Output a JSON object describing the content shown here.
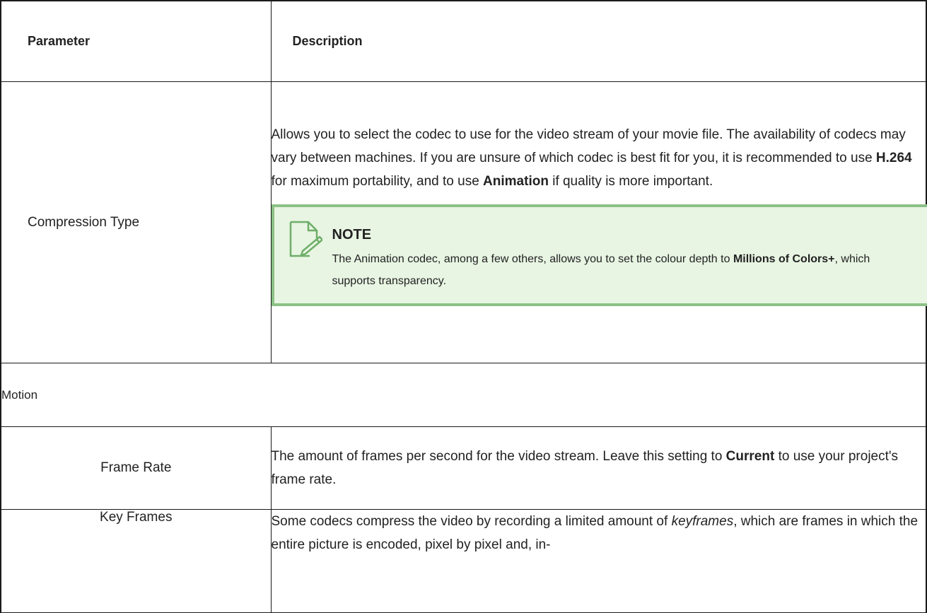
{
  "table": {
    "headers": {
      "parameter": "Parameter",
      "description": "Description"
    },
    "rows": {
      "compression_type": {
        "parameter": "Compression Type",
        "description_parts": {
          "p1": "Allows you to select the codec to use for the video stream of your movie file. The availability of codecs may vary between machines. If you are unsure of which codec is best fit for you, it is recommended to use ",
          "b1": "H.264",
          "p2": " for maximum portability, and to use ",
          "b2": "Animation",
          "p3": " if quality is more important."
        },
        "note": {
          "title": "NOTE",
          "text_parts": {
            "t1": "The Animation codec, among a few others, allows you to set the colour depth to ",
            "b1": "Millions of Colors+",
            "t2": ", which supports transparency."
          },
          "icon": "note-pencil-icon"
        }
      },
      "motion_section": {
        "label": "Motion"
      },
      "frame_rate": {
        "parameter": "Frame Rate",
        "description_parts": {
          "p1": "The amount of frames per second for the video stream. Leave this setting to ",
          "b1": "Current",
          "p2": " to use your project's frame rate."
        }
      },
      "key_frames": {
        "parameter": "Key Frames",
        "description_parts": {
          "p1": "Some codecs compress the video by recording a limited amount of ",
          "i1": "keyframes",
          "p2": ", which are frames in which the entire picture is encoded, pixel by pixel and, in-"
        }
      }
    }
  },
  "colors": {
    "note_background": "#e8f5e3",
    "note_border": "#8bc085",
    "note_icon_stroke": "#6fae69",
    "table_border": "#1a1a1a"
  }
}
